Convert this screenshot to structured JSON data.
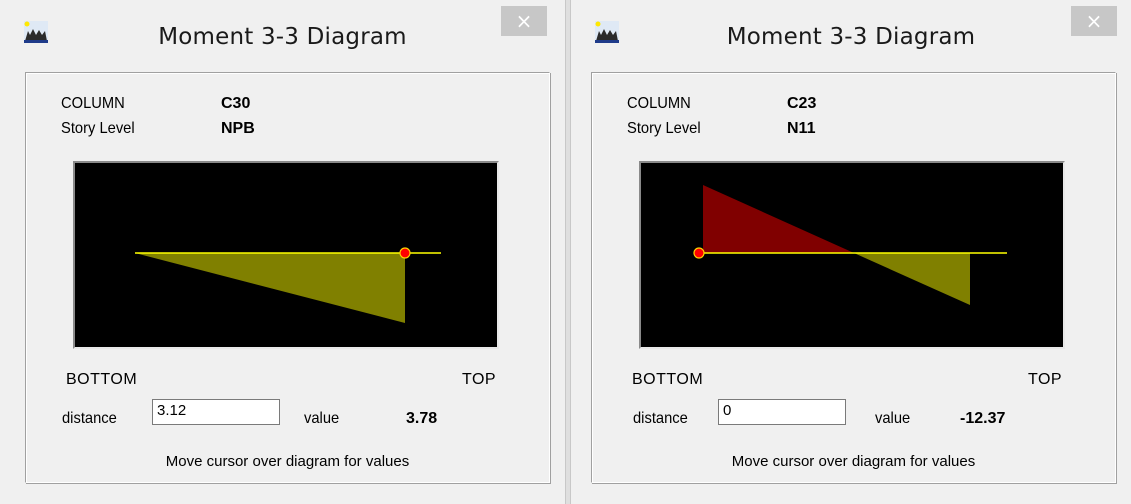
{
  "windows": [
    {
      "title": "Moment 3-3 Diagram",
      "close_label": "×",
      "column_label": "COLUMN",
      "column_value": "C30",
      "story_label": "Story Level",
      "story_value": "NPB",
      "bottom_label": "BOTTOM",
      "top_label": "TOP",
      "distance_label": "distance",
      "distance_value": "3.12",
      "value_label": "value",
      "value": "3.78",
      "hint": "Move cursor over diagram for values"
    },
    {
      "title": "Moment 3-3 Diagram",
      "close_label": "×",
      "column_label": "COLUMN",
      "column_value": "C23",
      "story_label": "Story Level",
      "story_value": "N11",
      "bottom_label": "BOTTOM",
      "top_label": "TOP",
      "distance_label": "distance",
      "distance_value": "0",
      "value_label": "value",
      "value": "-12.37",
      "hint": "Move cursor over diagram for values"
    }
  ],
  "colors": {
    "diagram_bg": "#000000",
    "positive_fill": "#808000",
    "negative_fill": "#800000",
    "axis_line": "#ffff00",
    "cursor_marker": "#ff0000"
  }
}
